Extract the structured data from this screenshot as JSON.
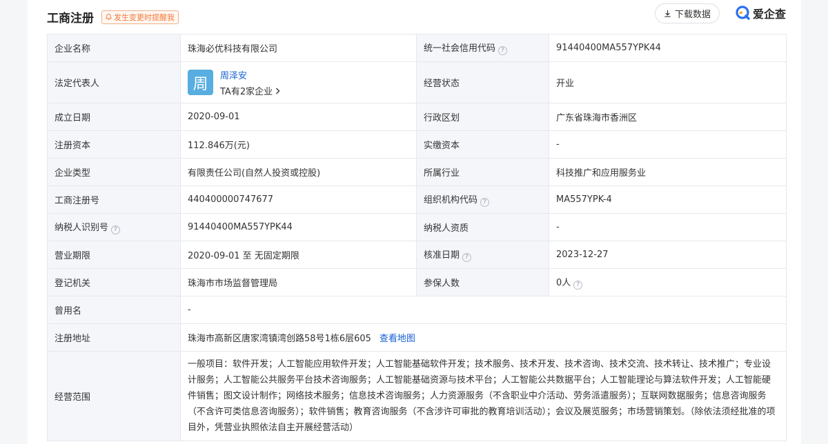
{
  "header": {
    "title": "工商注册",
    "remind_label": "发生变更时提醒我",
    "download_label": "下载数据",
    "brand": "爱企查"
  },
  "rows": {
    "company_name": {
      "label": "企业名称",
      "value": "珠海必优科技有限公司"
    },
    "credit_code": {
      "label": "统一社会信用代码",
      "value": "91440400MA557YPK44"
    },
    "legal_rep": {
      "label": "法定代表人",
      "avatar_char": "周",
      "name": "周泽安",
      "companies": "TA有2家企业"
    },
    "status": {
      "label": "经营状态",
      "value": "开业"
    },
    "founded": {
      "label": "成立日期",
      "value": "2020-09-01"
    },
    "region": {
      "label": "行政区划",
      "value": "广东省珠海市香洲区"
    },
    "reg_capital": {
      "label": "注册资本",
      "value": "112.846万(元)"
    },
    "paid_capital": {
      "label": "实缴资本",
      "value": "-"
    },
    "type": {
      "label": "企业类型",
      "value": "有限责任公司(自然人投资或控股)"
    },
    "industry": {
      "label": "所属行业",
      "value": "科技推广和应用服务业"
    },
    "reg_no": {
      "label": "工商注册号",
      "value": "440400000747677"
    },
    "org_code": {
      "label": "组织机构代码",
      "value": "MA557YPK-4"
    },
    "taxpayer_id": {
      "label": "纳税人识别号",
      "value": "91440400MA557YPK44"
    },
    "taxpayer_qual": {
      "label": "纳税人资质",
      "value": "-"
    },
    "term": {
      "label": "营业期限",
      "value": "2020-09-01 至 无固定期限"
    },
    "approve_date": {
      "label": "核准日期",
      "value": "2023-12-27"
    },
    "authority": {
      "label": "登记机关",
      "value": "珠海市市场监督管理局"
    },
    "insured": {
      "label": "参保人数",
      "value": "0人"
    },
    "former_name": {
      "label": "曾用名",
      "value": "-"
    },
    "address": {
      "label": "注册地址",
      "value": "珠海市高新区唐家湾镇湾创路58号1栋6层605",
      "map_link": "查看地图"
    },
    "scope": {
      "label": "经营范围",
      "value": "一般项目：软件开发；人工智能应用软件开发；人工智能基础软件开发；技术服务、技术开发、技术咨询、技术交流、技术转让、技术推广；专业设计服务；人工智能公共服务平台技术咨询服务；人工智能基础资源与技术平台；人工智能公共数据平台；人工智能理论与算法软件开发；人工智能硬件销售；图文设计制作；网络技术服务；信息技术咨询服务；人力资源服务（不含职业中介活动、劳务派遣服务）；互联网数据服务；信息咨询服务（不含许可类信息咨询服务）；软件销售；教育咨询服务（不含涉许可审批的教育培训活动）；会议及展览服务；市场营销策划。（除依法须经批准的项目外，凭营业执照依法自主开展经营活动）"
    }
  },
  "colors": {
    "accent_link": "#1460d2",
    "avatar_bg": "#58aee0",
    "remind": "#f17b3a",
    "label_bg": "#f4f6fa"
  }
}
